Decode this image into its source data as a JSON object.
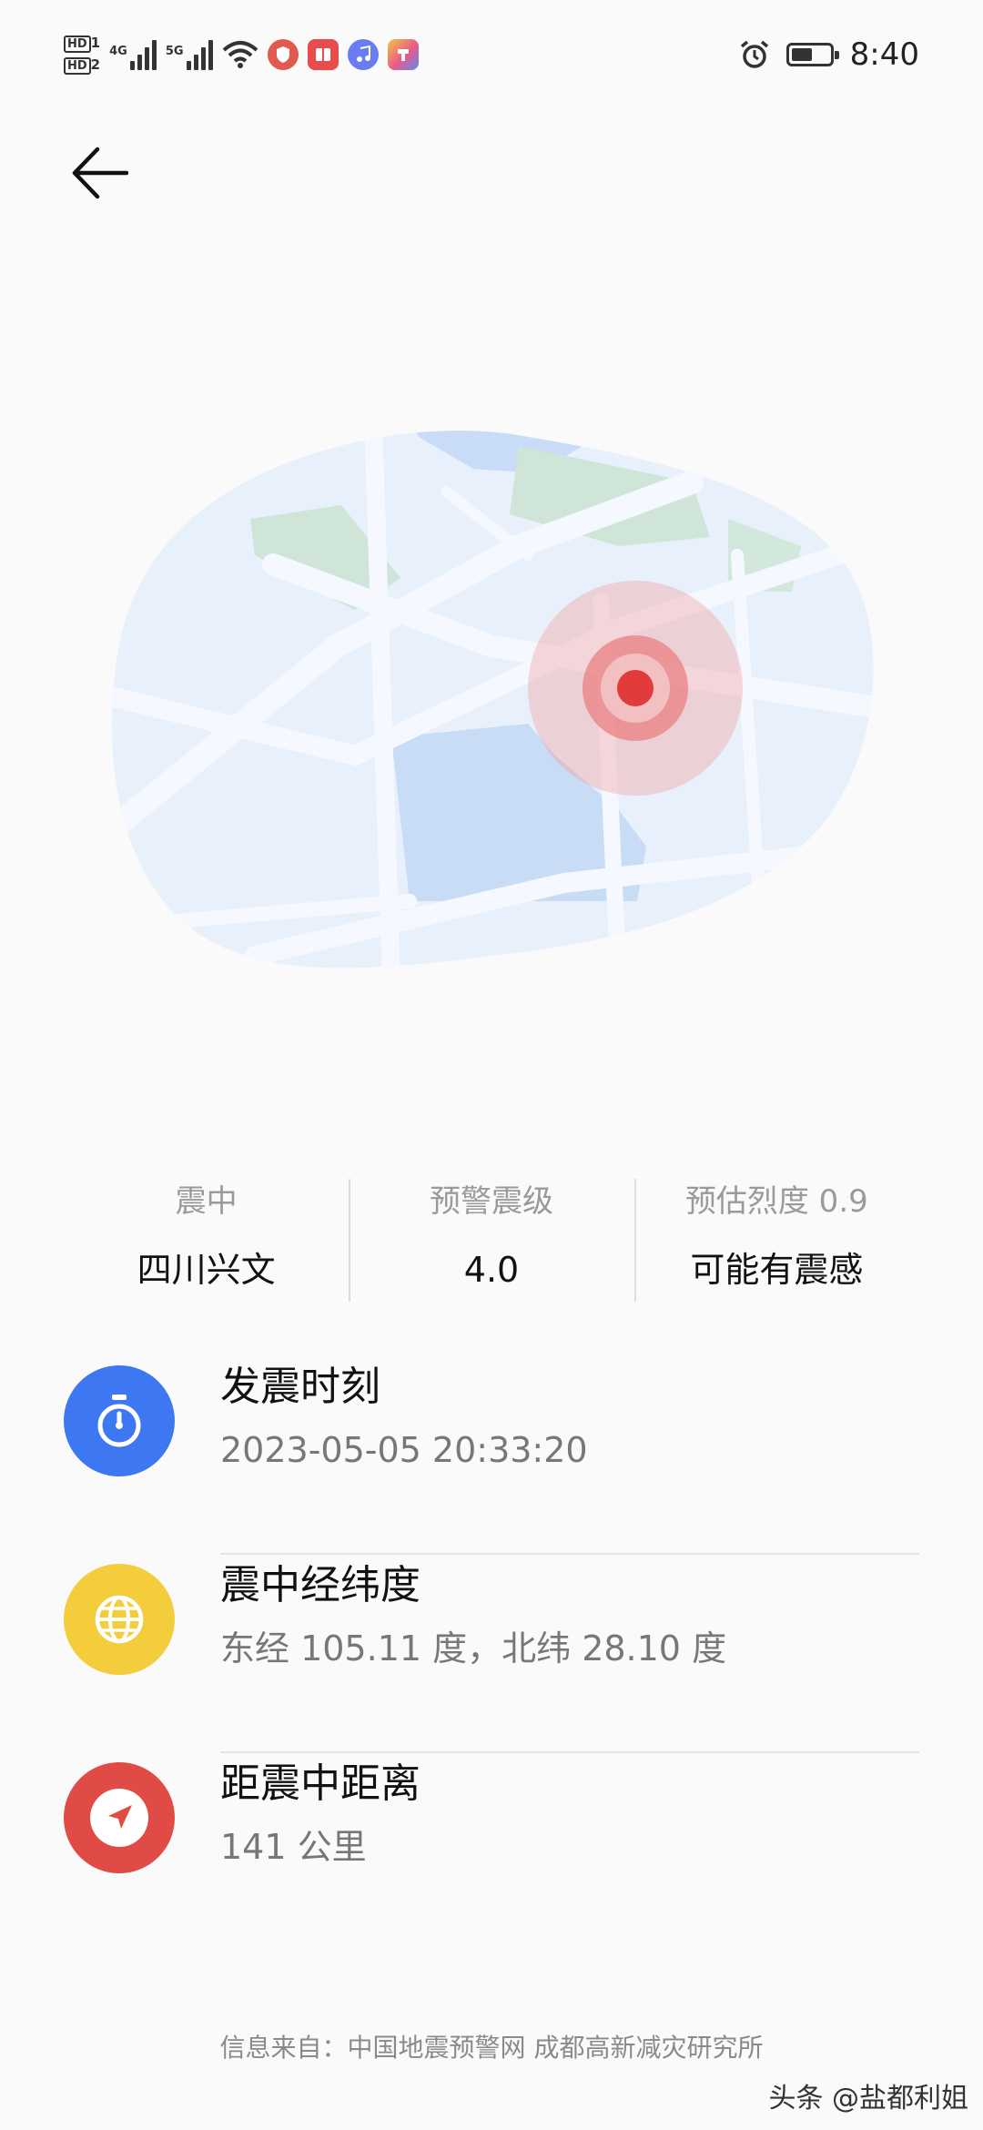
{
  "status_bar": {
    "hd1": "HD",
    "hd1_sim": "1",
    "hd2": "HD",
    "hd2_sim": "2",
    "net1": "4G",
    "net2": "5G",
    "time": "8:40",
    "battery_level": 0.55,
    "app_icons": [
      "shield-app-icon",
      "book-app-icon",
      "music-app-icon",
      "app-store-icon"
    ]
  },
  "header": {
    "back_icon": "arrow-left-icon"
  },
  "summary": {
    "epicenter_label": "震中",
    "epicenter_value": "四川兴文",
    "magnitude_label": "预警震级",
    "magnitude_value": "4.0",
    "intensity_label": "预估烈度 0.9",
    "intensity_value": "可能有震感"
  },
  "details": [
    {
      "icon": "stopwatch-icon",
      "color": "#3d78f2",
      "title": "发震时刻",
      "value": "2023-05-05 20:33:20"
    },
    {
      "icon": "globe-icon",
      "color": "#f4cd3d",
      "title": "震中经纬度",
      "value": "东经 105.11 度，北纬 28.10 度"
    },
    {
      "icon": "navigation-arrow-icon",
      "color": "#e04b45",
      "title": "距震中距离",
      "value": "141 公里"
    }
  ],
  "footer": {
    "source": "信息来自：中国地震预警网 成都高新减灾研究所",
    "watermark": "头条 @盐都利姐"
  }
}
